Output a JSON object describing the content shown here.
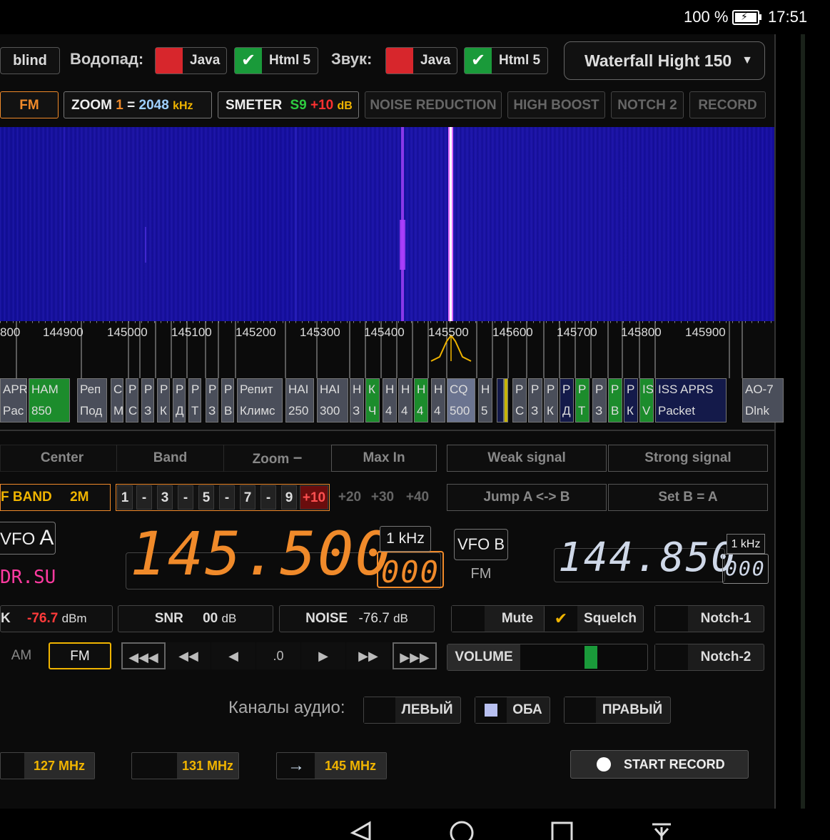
{
  "status": {
    "battery": "100 %",
    "time": "17:51"
  },
  "top": {
    "blind": "blind",
    "waterfall_label": "Водопад:",
    "java": "Java",
    "html5": "Html 5",
    "sound_label": "Звук:",
    "waterfall_select": "Waterfall Hight 150"
  },
  "toolbar": {
    "fm": "FM",
    "zoom": "ZOOM",
    "zoom_val": "1",
    "zoom_eq": "=",
    "zoom_khz": "2048",
    "zoom_unit": "kHz",
    "smeter": "SMETER",
    "smeter_s": "S9",
    "smeter_plus": "+10",
    "smeter_db": "dB",
    "noise_reduction": "NOISE REDUCTION",
    "high_boost": "HIGH BOOST",
    "notch2": "NOTCH 2",
    "record": "RECORD"
  },
  "scale": {
    "ticks": [
      "800",
      "144900",
      "145000",
      "145100",
      "145200",
      "145300",
      "145400",
      "145500",
      "145600",
      "145700",
      "145800",
      "145900"
    ]
  },
  "bookmarks": [
    {
      "l1": "APR",
      "l2": "Pac"
    },
    {
      "l1": "HAM",
      "l2": "850"
    },
    {
      "l1": "Реп",
      "l2": "Под"
    },
    {
      "l1": "С",
      "l2": "М"
    },
    {
      "l1": "Р",
      "l2": "С"
    },
    {
      "l1": "Р",
      "l2": "З"
    },
    {
      "l1": "Р",
      "l2": "К"
    },
    {
      "l1": "Р",
      "l2": "Д"
    },
    {
      "l1": "Р",
      "l2": "Т"
    },
    {
      "l1": "Р",
      "l2": "З"
    },
    {
      "l1": "Р",
      "l2": "В"
    },
    {
      "l1": "Репит",
      "l2": "Климс"
    },
    {
      "l1": "HAI",
      "l2": "250"
    },
    {
      "l1": "HAI",
      "l2": "300"
    },
    {
      "l1": "Н",
      "l2": "З"
    },
    {
      "l1": "К",
      "l2": "Ч"
    },
    {
      "l1": "Н",
      "l2": "4"
    },
    {
      "l1": "Н",
      "l2": "4"
    },
    {
      "l1": "Н",
      "l2": "4"
    },
    {
      "l1": "Н",
      "l2": "4"
    },
    {
      "l1": "CQ",
      "l2": "500"
    },
    {
      "l1": "Н",
      "l2": "5"
    },
    {
      "l1": "Р",
      "l2": "С"
    },
    {
      "l1": "Р",
      "l2": "З"
    },
    {
      "l1": "Р",
      "l2": "К"
    },
    {
      "l1": "Р",
      "l2": "Д"
    },
    {
      "l1": "Р",
      "l2": "Т"
    },
    {
      "l1": "Р",
      "l2": "З"
    },
    {
      "l1": "Р",
      "l2": "В"
    },
    {
      "l1": "Р",
      "l2": "К"
    },
    {
      "l1": "IS",
      "l2": "V"
    },
    {
      "l1": "ISS APRS",
      "l2": "Packet"
    },
    {
      "l1": "AO-7",
      "l2": "Dlnk"
    }
  ],
  "nav": {
    "center": "Center",
    "band": "Band",
    "zoom": "Zoom",
    "max_in": "Max In",
    "weak": "Weak signal",
    "strong": "Strong signal",
    "jump": "Jump A <-> B",
    "set_b": "Set B = A"
  },
  "band": {
    "label": "F BAND",
    "value": "2M",
    "steps": [
      "1",
      "-",
      "3",
      "-",
      "5",
      "-",
      "7",
      "-",
      "9",
      "+10",
      "+20",
      "+30",
      "+40"
    ]
  },
  "vfo_a": {
    "label": "VFO",
    "letter": "A",
    "freq": "145.500",
    "sub": "000",
    "step": "1 kHz",
    "callsign": "DR.SU"
  },
  "vfo_b": {
    "label": "VFO B",
    "mode": "FM",
    "freq": "144.850",
    "sub": "000",
    "step": "1 kHz"
  },
  "meters": {
    "peak_label": "K",
    "peak_val": "-76.7",
    "peak_unit": "dBm",
    "snr_label": "SNR",
    "snr_val": "00",
    "snr_unit": "dB",
    "noise_label": "NOISE",
    "noise_val": "-76.7",
    "noise_unit": "dB"
  },
  "switches": {
    "mute": "Mute",
    "squelch": "Squelch",
    "notch1": "Notch-1",
    "notch2": "Notch-2",
    "volume": "VOLUME",
    "volume_level": 0.56
  },
  "modes": {
    "am": "AM",
    "fm": "FM"
  },
  "tune": [
    "◀◀◀",
    "◀◀",
    "◀",
    ".0",
    "▶",
    "▶▶",
    "▶▶▶"
  ],
  "audio": {
    "label": "Каналы аудио:",
    "left": "ЛЕВЫЙ",
    "both": "ОБА",
    "right": "ПРАВЫЙ"
  },
  "quick": {
    "f1": "127 MHz",
    "f2": "131 MHz",
    "f3": "145 MHz",
    "arrow": "→",
    "record": "START RECORD"
  },
  "colors": {
    "orange": "#f08a2a",
    "green": "#1a9a3a",
    "red": "#d7262c",
    "accent": "#f0b400"
  }
}
